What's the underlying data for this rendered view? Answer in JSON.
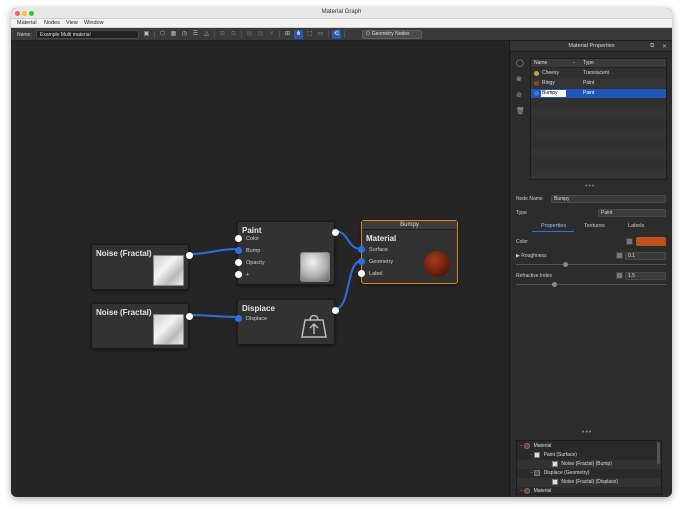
{
  "window": {
    "title": "Material Graph"
  },
  "menubar": {
    "items": [
      "Material",
      "Nodes",
      "View",
      "Window"
    ]
  },
  "toolbar": {
    "name_label": "Name:",
    "name_value": "Example Multi material",
    "geometry_nodes_label": "Geometry Nodes"
  },
  "nodes": {
    "noise1": {
      "title": "Noise (Fractal)"
    },
    "noise2": {
      "title": "Noise (Fractal)"
    },
    "paint": {
      "title": "Paint",
      "inputs": [
        "Color",
        "Bump",
        "Opacity",
        "+"
      ]
    },
    "displace": {
      "title": "Displace",
      "inputs": [
        "Displace"
      ]
    },
    "material": {
      "header": "Bumpy",
      "title": "Material",
      "inputs": [
        "Surface",
        "Geometry",
        "Label"
      ]
    }
  },
  "panel": {
    "title": "Material Properties",
    "table": {
      "headers": [
        "Name",
        "Type"
      ],
      "rows": [
        {
          "name": "Cheesy",
          "type": "Translucent",
          "color": "#c9a13a"
        },
        {
          "name": "Ringy",
          "type": "Paint",
          "color": "#8a4a1e"
        },
        {
          "name": "Bumpy",
          "type": "Paint",
          "color": "#4a6fd8"
        }
      ]
    },
    "node_name_label": "Node Name",
    "node_name_value": "Bumpy",
    "type_label": "Type",
    "type_value": "Paint",
    "tabs": [
      "Properties",
      "Textures",
      "Labels"
    ],
    "color_label": "Color",
    "color_value": "#c0501c",
    "roughness_label": "Roughness",
    "roughness_value": "0.1",
    "refractive_label": "Refractive Index",
    "refractive_value": "1.5",
    "tree": [
      "Material",
      "Paint (Surface)",
      "Noise (Fractal) (Bump)",
      "Displace (Geometry)",
      "Noise (Fractal) (Displace)",
      "Material"
    ]
  },
  "colors": {
    "accent": "#2b5aa8",
    "selected_node_border": "#d88a2a",
    "wire": "#2d6fe0"
  }
}
